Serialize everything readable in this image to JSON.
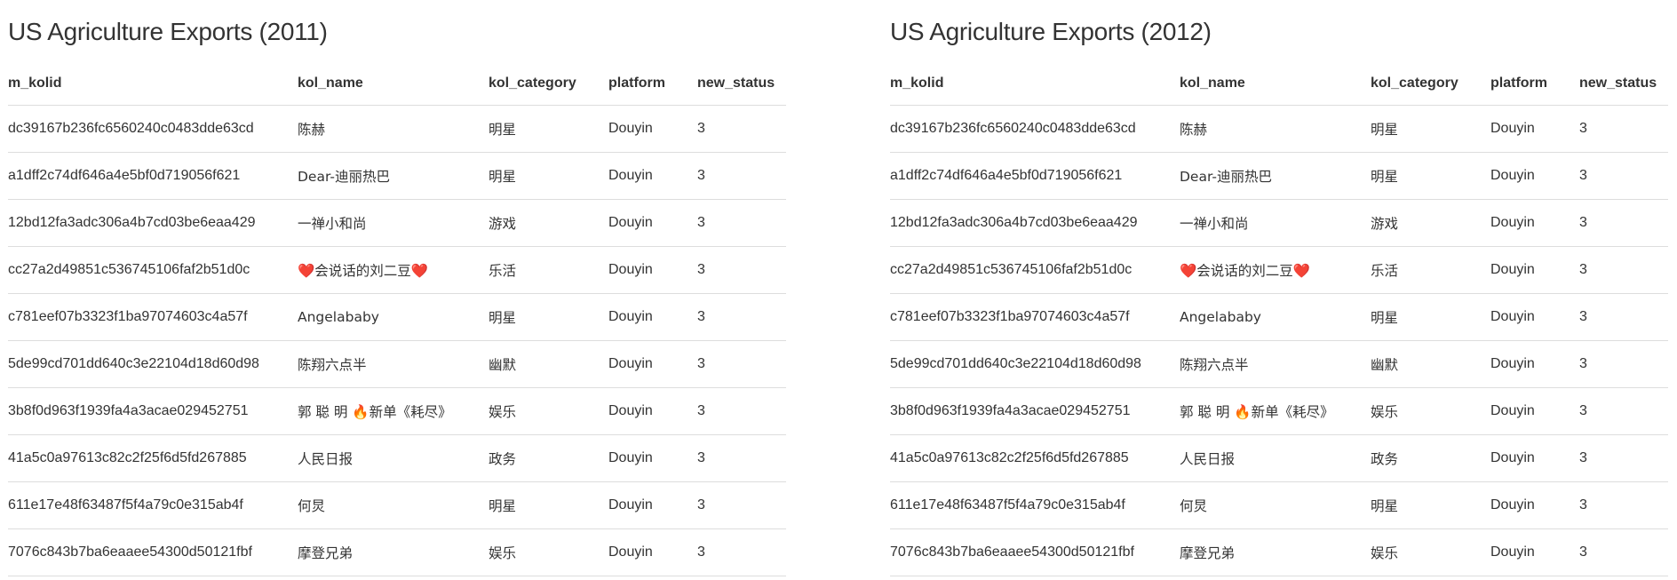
{
  "tables": [
    {
      "title": "US Agriculture Exports (2011)",
      "columns": [
        "m_kolid",
        "kol_name",
        "kol_category",
        "platform",
        "new_status"
      ],
      "rows": [
        [
          "dc39167b236fc6560240c0483dde63cd",
          "陈赫",
          "明星",
          "Douyin",
          "3"
        ],
        [
          "a1dff2c74df646a4e5bf0d719056f621",
          "Dear-迪丽热巴",
          "明星",
          "Douyin",
          "3"
        ],
        [
          "12bd12fa3adc306a4b7cd03be6eaa429",
          "一禅小和尚",
          "游戏",
          "Douyin",
          "3"
        ],
        [
          "cc27a2d49851c536745106faf2b51d0c",
          "❤️会说话的刘二豆❤️",
          "乐活",
          "Douyin",
          "3"
        ],
        [
          "c781eef07b3323f1ba97074603c4a57f",
          "Angelababy",
          "明星",
          "Douyin",
          "3"
        ],
        [
          "5de99cd701dd640c3e22104d18d60d98",
          "陈翔六点半",
          "幽默",
          "Douyin",
          "3"
        ],
        [
          "3b8f0d963f1939fa4a3acae029452751",
          "郭 聪 明 🔥新单《耗尽》",
          "娱乐",
          "Douyin",
          "3"
        ],
        [
          "41a5c0a97613c82c2f25f6d5fd267885",
          "人民日报",
          "政务",
          "Douyin",
          "3"
        ],
        [
          "611e17e48f63487f5f4a79c0e315ab4f",
          "何炅",
          "明星",
          "Douyin",
          "3"
        ],
        [
          "7076c843b7ba6eaaee54300d50121fbf",
          "摩登兄弟",
          "娱乐",
          "Douyin",
          "3"
        ]
      ]
    },
    {
      "title": "US Agriculture Exports (2012)",
      "columns": [
        "m_kolid",
        "kol_name",
        "kol_category",
        "platform",
        "new_status"
      ],
      "rows": [
        [
          "dc39167b236fc6560240c0483dde63cd",
          "陈赫",
          "明星",
          "Douyin",
          "3"
        ],
        [
          "a1dff2c74df646a4e5bf0d719056f621",
          "Dear-迪丽热巴",
          "明星",
          "Douyin",
          "3"
        ],
        [
          "12bd12fa3adc306a4b7cd03be6eaa429",
          "一禅小和尚",
          "游戏",
          "Douyin",
          "3"
        ],
        [
          "cc27a2d49851c536745106faf2b51d0c",
          "❤️会说话的刘二豆❤️",
          "乐活",
          "Douyin",
          "3"
        ],
        [
          "c781eef07b3323f1ba97074603c4a57f",
          "Angelababy",
          "明星",
          "Douyin",
          "3"
        ],
        [
          "5de99cd701dd640c3e22104d18d60d98",
          "陈翔六点半",
          "幽默",
          "Douyin",
          "3"
        ],
        [
          "3b8f0d963f1939fa4a3acae029452751",
          "郭 聪 明 🔥新单《耗尽》",
          "娱乐",
          "Douyin",
          "3"
        ],
        [
          "41a5c0a97613c82c2f25f6d5fd267885",
          "人民日报",
          "政务",
          "Douyin",
          "3"
        ],
        [
          "611e17e48f63487f5f4a79c0e315ab4f",
          "何炅",
          "明星",
          "Douyin",
          "3"
        ],
        [
          "7076c843b7ba6eaaee54300d50121fbf",
          "摩登兄弟",
          "娱乐",
          "Douyin",
          "3"
        ]
      ]
    }
  ]
}
